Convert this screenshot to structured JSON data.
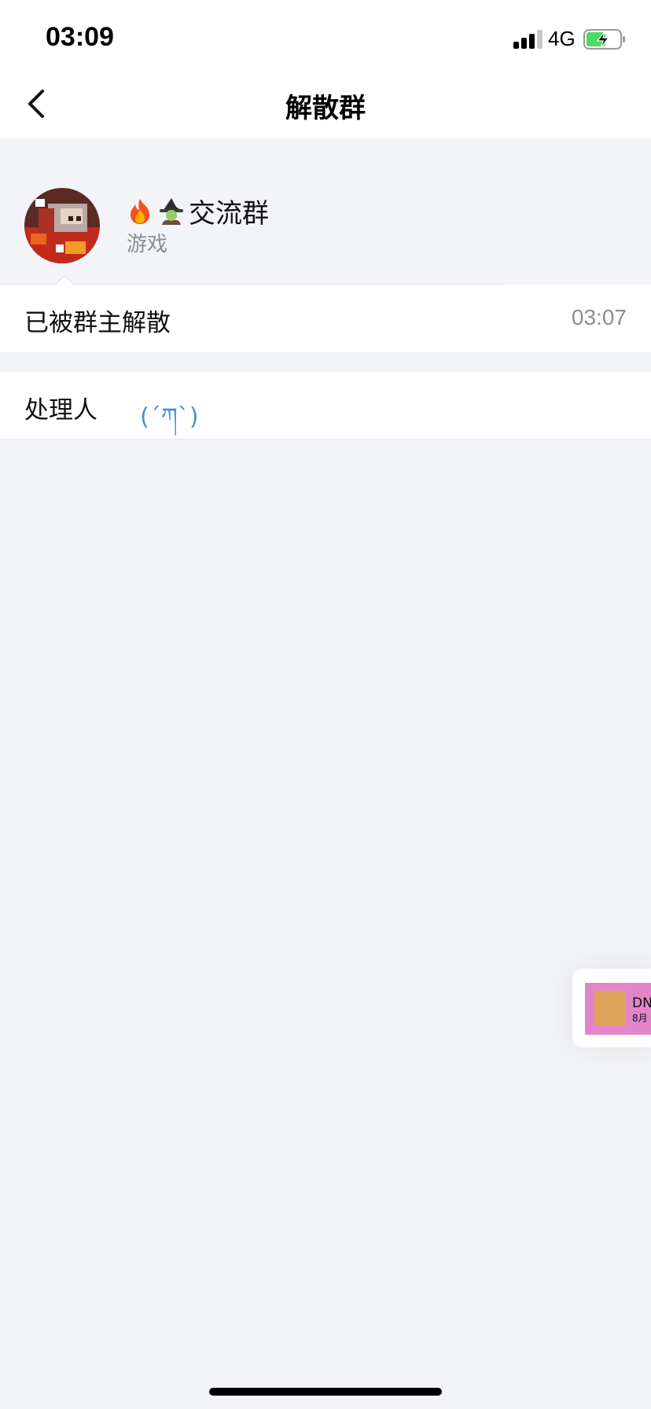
{
  "status_bar": {
    "time": "03:09",
    "network": "4G",
    "battery_icon": "battery-charging-icon",
    "signal_icon": "cellular-signal-icon"
  },
  "nav": {
    "title": "解散群",
    "back_icon": "chevron-left-icon"
  },
  "group": {
    "name_emojis": [
      "fire-emoji",
      "witch-emoji"
    ],
    "name": "交流群",
    "category": "游戏",
    "avatar_icon": "group-avatar"
  },
  "status_row": {
    "label": "已被群主解散",
    "time": "03:07"
  },
  "handler_row": {
    "label": "处理人",
    "name": "(´ཀ`)"
  },
  "floating_card": {
    "title": "DN",
    "subtitle": "8月"
  },
  "colors": {
    "background": "#f3f4f8",
    "link": "#4a8fd6",
    "secondary_text": "#8a8e99",
    "battery_green": "#4cd964",
    "float_thumb": "#e286c9"
  }
}
